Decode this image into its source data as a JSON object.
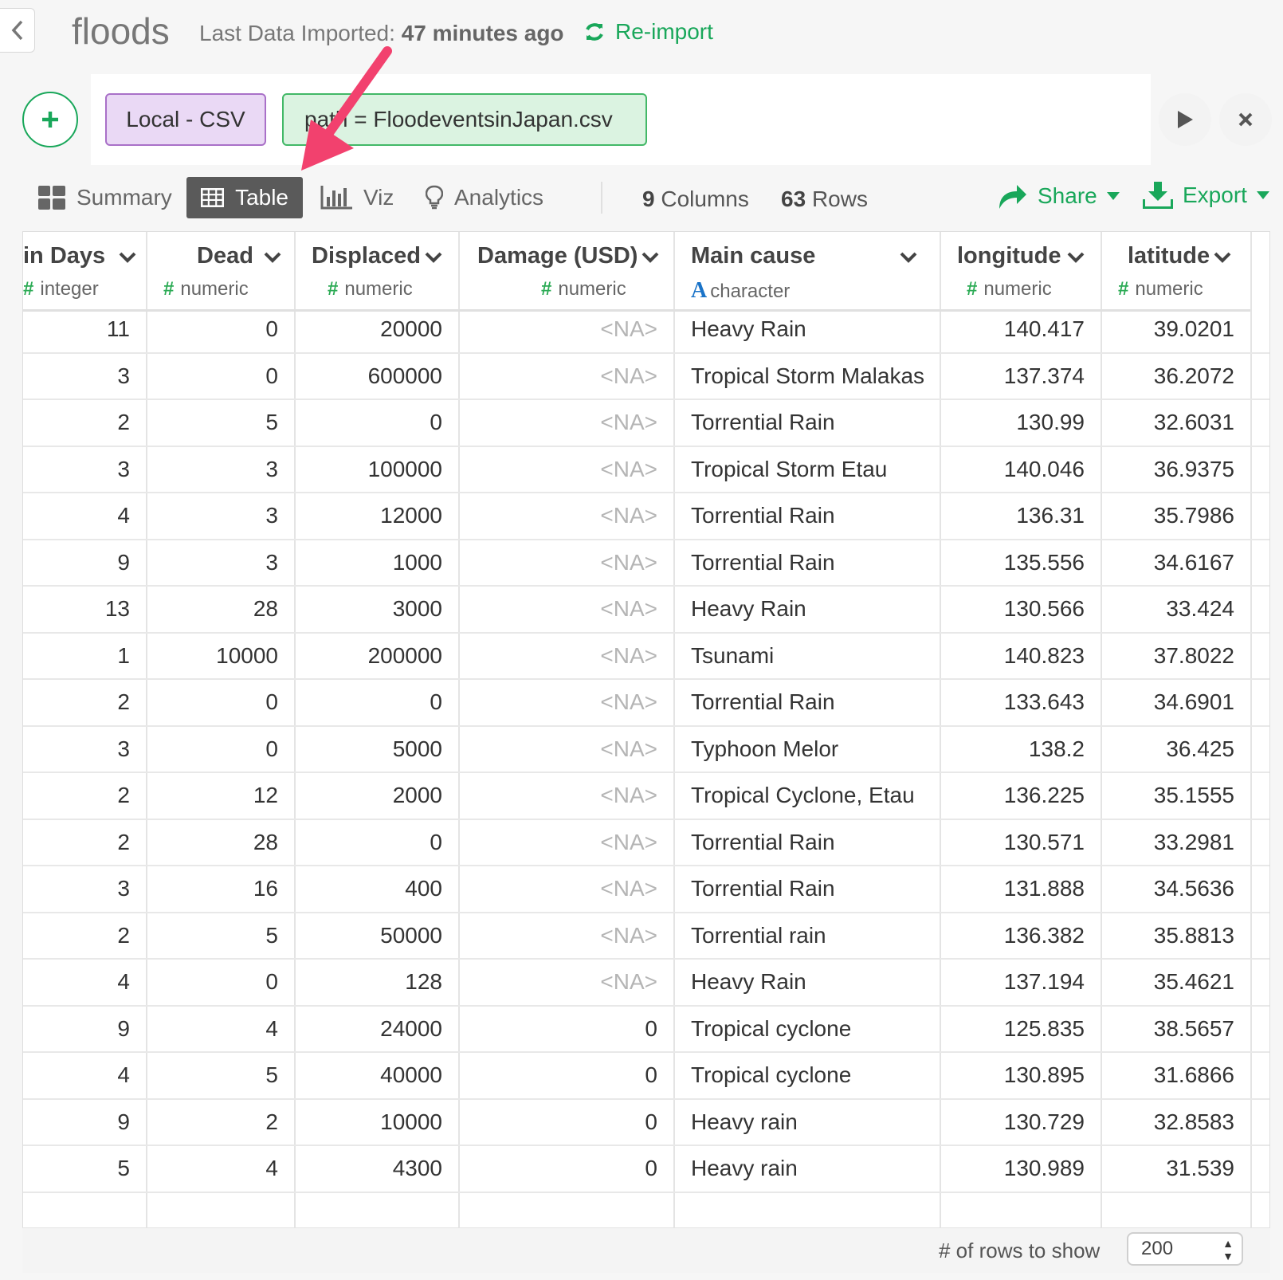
{
  "header": {
    "title": "floods",
    "last_imported_label": "Last Data Imported:",
    "last_imported_value": "47 minutes ago",
    "reimport_label": "Re-import"
  },
  "steps": {
    "source_label": "Local - CSV",
    "path_label": "path = FloodeventsinJapan.csv"
  },
  "tabs": [
    {
      "label": "Summary",
      "icon": "summary-icon",
      "active": false
    },
    {
      "label": "Table",
      "icon": "table-icon",
      "active": true
    },
    {
      "label": "Viz",
      "icon": "bar-chart-icon",
      "active": false
    },
    {
      "label": "Analytics",
      "icon": "lightbulb-icon",
      "active": false
    }
  ],
  "counts": {
    "columns_num": "9",
    "columns_label": "Columns",
    "rows_num": "63",
    "rows_label": "Rows"
  },
  "actions": {
    "share_label": "Share",
    "export_label": "Export"
  },
  "columns": [
    {
      "name": "in Days",
      "type": "integer",
      "type_symbol": "#"
    },
    {
      "name": "Dead",
      "type": "numeric",
      "type_symbol": "#"
    },
    {
      "name": "Displaced",
      "type": "numeric",
      "type_symbol": "#"
    },
    {
      "name": "Damage (USD)",
      "type": "numeric",
      "type_symbol": "#"
    },
    {
      "name": "Main cause",
      "type": "character",
      "type_symbol": "A"
    },
    {
      "name": "longitude",
      "type": "numeric",
      "type_symbol": "#"
    },
    {
      "name": "latitude",
      "type": "numeric",
      "type_symbol": "#"
    }
  ],
  "rows": [
    [
      "11",
      "0",
      "20000",
      "<NA>",
      "Heavy Rain",
      "140.417",
      "39.0201"
    ],
    [
      "3",
      "0",
      "600000",
      "<NA>",
      "Tropical Storm Malakas",
      "137.374",
      "36.2072"
    ],
    [
      "2",
      "5",
      "0",
      "<NA>",
      "Torrential Rain",
      "130.99",
      "32.6031"
    ],
    [
      "3",
      "3",
      "100000",
      "<NA>",
      "Tropical Storm Etau",
      "140.046",
      "36.9375"
    ],
    [
      "4",
      "3",
      "12000",
      "<NA>",
      "Torrential Rain",
      "136.31",
      "35.7986"
    ],
    [
      "9",
      "3",
      "1000",
      "<NA>",
      "Torrential Rain",
      "135.556",
      "34.6167"
    ],
    [
      "13",
      "28",
      "3000",
      "<NA>",
      "Heavy Rain",
      "130.566",
      "33.424"
    ],
    [
      "1",
      "10000",
      "200000",
      "<NA>",
      "Tsunami",
      "140.823",
      "37.8022"
    ],
    [
      "2",
      "0",
      "0",
      "<NA>",
      "Torrential Rain",
      "133.643",
      "34.6901"
    ],
    [
      "3",
      "0",
      "5000",
      "<NA>",
      "Typhoon Melor",
      "138.2",
      "36.425"
    ],
    [
      "2",
      "12",
      "2000",
      "<NA>",
      "Tropical Cyclone, Etau",
      "136.225",
      "35.1555"
    ],
    [
      "2",
      "28",
      "0",
      "<NA>",
      "Torrential Rain",
      "130.571",
      "33.2981"
    ],
    [
      "3",
      "16",
      "400",
      "<NA>",
      "Torrential Rain",
      "131.888",
      "34.5636"
    ],
    [
      "2",
      "5",
      "50000",
      "<NA>",
      "Torrential rain",
      "136.382",
      "35.8813"
    ],
    [
      "4",
      "0",
      "128",
      "<NA>",
      "Heavy Rain",
      "137.194",
      "35.4621"
    ],
    [
      "9",
      "4",
      "24000",
      "0",
      "Tropical cyclone",
      "125.835",
      "38.5657"
    ],
    [
      "4",
      "5",
      "40000",
      "0",
      "Tropical cyclone",
      "130.895",
      "31.6866"
    ],
    [
      "9",
      "2",
      "10000",
      "0",
      "Heavy rain",
      "130.729",
      "32.8583"
    ],
    [
      "5",
      "4",
      "4300",
      "0",
      "Heavy rain",
      "130.989",
      "31.539"
    ]
  ],
  "footer": {
    "rows_to_show_label": "# of rows to show",
    "rows_to_show_value": "200"
  },
  "colors": {
    "accent_green": "#19a75a",
    "annotation_arrow": "#f2416e",
    "source_chip": "#ead9f5",
    "path_chip": "#dbf3e1"
  }
}
